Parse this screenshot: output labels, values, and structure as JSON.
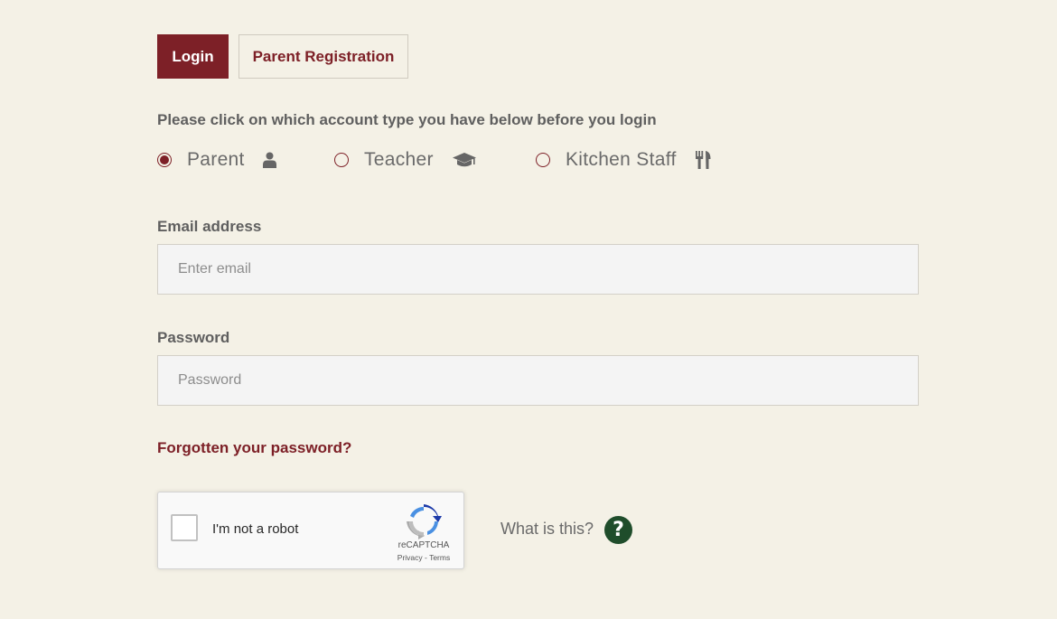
{
  "tabs": {
    "login": "Login",
    "registration": "Parent Registration"
  },
  "instruction": "Please click on which account type you have below before you login",
  "account_types": [
    {
      "label": "Parent",
      "icon": "user-icon",
      "selected": true
    },
    {
      "label": "Teacher",
      "icon": "graduation-cap-icon",
      "selected": false
    },
    {
      "label": "Kitchen Staff",
      "icon": "utensils-icon",
      "selected": false
    }
  ],
  "email": {
    "label": "Email address",
    "placeholder": "Enter email",
    "value": ""
  },
  "password": {
    "label": "Password",
    "placeholder": "Password",
    "value": ""
  },
  "forgot_password": "Forgotten your password?",
  "captcha": {
    "text": "I'm not a robot",
    "brand": "reCAPTCHA",
    "links": "Privacy - Terms"
  },
  "help": {
    "text": "What is this?",
    "icon": "question-icon"
  },
  "colors": {
    "accent": "#7d2027",
    "background": "#f4f1e6",
    "help_icon": "#1f4d2b"
  }
}
